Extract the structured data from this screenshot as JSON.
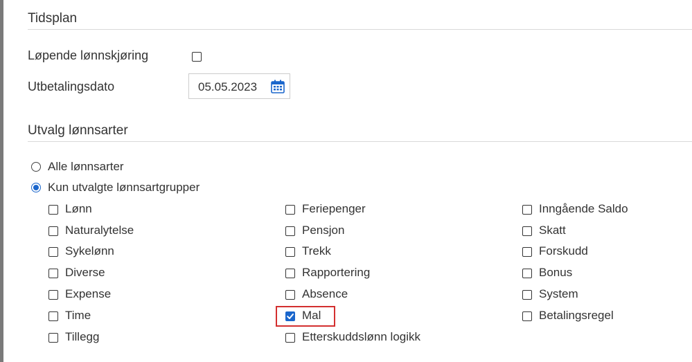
{
  "schedule": {
    "title": "Tidsplan",
    "running_payroll_label": "Løpende lønnskjøring",
    "running_payroll_checked": false,
    "payment_date_label": "Utbetalingsdato",
    "payment_date_value": "05.05.2023"
  },
  "selection": {
    "title": "Utvalg lønnsarter",
    "radio_all_label": "Alle lønnsarter",
    "radio_selected_groups_label": "Kun utvalgte lønnsartgrupper",
    "selected_radio": "selected_groups"
  },
  "groups": {
    "col1": [
      {
        "label": "Lønn",
        "checked": false
      },
      {
        "label": "Naturalytelse",
        "checked": false
      },
      {
        "label": "Sykelønn",
        "checked": false
      },
      {
        "label": "Diverse",
        "checked": false
      },
      {
        "label": "Expense",
        "checked": false
      },
      {
        "label": "Time",
        "checked": false
      },
      {
        "label": "Tillegg",
        "checked": false
      }
    ],
    "col2": [
      {
        "label": "Feriepenger",
        "checked": false
      },
      {
        "label": "Pensjon",
        "checked": false
      },
      {
        "label": "Trekk",
        "checked": false
      },
      {
        "label": "Rapportering",
        "checked": false
      },
      {
        "label": "Absence",
        "checked": false
      },
      {
        "label": "Mal",
        "checked": true
      },
      {
        "label": "Etterskuddslønn logikk",
        "checked": false
      }
    ],
    "col3": [
      {
        "label": "Inngående Saldo",
        "checked": false
      },
      {
        "label": "Skatt",
        "checked": false
      },
      {
        "label": "Forskudd",
        "checked": false
      },
      {
        "label": "Bonus",
        "checked": false
      },
      {
        "label": "System",
        "checked": false
      },
      {
        "label": "Betalingsregel",
        "checked": false
      }
    ]
  },
  "colors": {
    "accent": "#1a66cc",
    "highlight": "#d32f2f",
    "text": "#333333"
  },
  "icons": {
    "date_picker": "calendar-icon"
  }
}
